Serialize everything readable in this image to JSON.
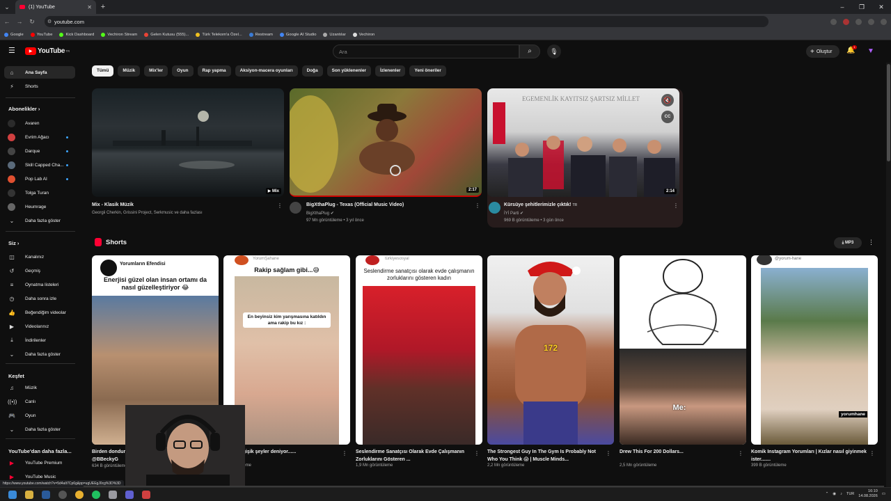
{
  "browser": {
    "tab_title": "(1) YouTube",
    "url": "youtube.com",
    "bookmarks": [
      "Google",
      "YouTube",
      "Kick Dashboard",
      "Vechiron Stream",
      "Gelen Kutusu (555)...",
      "Türk Telekom'a Özel...",
      "Restream",
      "Google AI Studio",
      "Uzantılar",
      "Vechiron"
    ],
    "status_url": "https://www.youtube.com/watch?v=5d4aIt7Cp6g&pp=ugUEEgJ0cg%3D%3D"
  },
  "header": {
    "logo": "YouTube",
    "logo_region": "TR",
    "search_placeholder": "Ara",
    "create_label": "Oluştur",
    "notification_count": "1"
  },
  "sidebar": {
    "home": "Ana Sayfa",
    "shorts": "Shorts",
    "subscriptions_title": "Abonelikler",
    "subscriptions": [
      {
        "name": "Avaren",
        "color": "#2b2b2b",
        "dot": false
      },
      {
        "name": "Evrim Ağacı",
        "color": "#d04040",
        "dot": true
      },
      {
        "name": "Darque",
        "color": "#444",
        "dot": true
      },
      {
        "name": "Skill Capped Cha...",
        "color": "#5a6a7a",
        "dot": true
      },
      {
        "name": "Pop Lab AI",
        "color": "#e05030",
        "dot": true
      },
      {
        "name": "Tolga Turan",
        "color": "#333",
        "dot": false
      },
      {
        "name": "Heumrage",
        "color": "#666",
        "dot": false
      }
    ],
    "show_more": "Daha fazla göster",
    "you_title": "Siz",
    "you_items": [
      "Kanalınız",
      "Geçmiş",
      "Oynatma listeleri",
      "Daha sonra izle",
      "Beğendiğim videolar",
      "Videolarınız",
      "İndirilenler",
      "Daha fazla göster"
    ],
    "explore_title": "Keşfet",
    "explore_items": [
      "Müzik",
      "Canlı",
      "Oyun",
      "Daha fazla göster"
    ],
    "more_title": "YouTube'dan daha fazla...",
    "more_items": [
      "YouTube Premium",
      "YouTube Music"
    ]
  },
  "chips": [
    "Tümü",
    "Müzik",
    "Mix'ler",
    "Oyun",
    "Rap yapma",
    "Aksiyon-macera oyunları",
    "Doğa",
    "Son yüklenenler",
    "İzlenenler",
    "Yeni öneriler"
  ],
  "videos": [
    {
      "title": "Mix - Klasik Müzik",
      "meta": "Georgii Cherkin, Grissini Project, Serkmusic ve daha fazlası",
      "badge": "Mix",
      "channel": "",
      "stats": ""
    },
    {
      "title": "BigXthaPlug - Texas (Official Music Video)",
      "channel": "BigXthaPlug",
      "stats": "97 Mn görüntüleme • 3 yıl önce",
      "badge": "2:17"
    },
    {
      "title": "Kürsüye şehitlerimizle çıktık!",
      "title_badge": "TR",
      "channel": "İYİ Parti",
      "stats": "969 B görüntüleme • 3 gün önce",
      "badge": "2:14"
    }
  ],
  "shorts": {
    "title": "Shorts",
    "mp3_label": "MP3",
    "items": [
      {
        "title": "Birden dondurmacılık yapmaya başlayan turist😂 @BBeckyG",
        "views": "634 B görüntüleme",
        "overlay_channel": "Yorumların Efendisi",
        "overlay_text": "Enerjisi güzel olan insan ortamı da nasıl güzelleştiriyor 😂"
      },
      {
        "title": "...ınız değişik şeyler deniyor......",
        "views": "... görüntüleme",
        "overlay_channel": "YorumŞahane",
        "overlay_text": "Rakip sağlam gibi...😅",
        "overlay_text2": "En beyinsiz kim yarışmasına katıldın ama rakip bu kız :"
      },
      {
        "title": "Seslendirme Sanatçısı Olarak Evde Çalışmanın Zorluklarını Gösteren ...",
        "views": "1,9 Mn görüntüleme",
        "overlay_channel": "türkiyesosyal",
        "overlay_text": "Seslendirme sanatçısı olarak evde çalışmanın zorluklarını gösteren kadın"
      },
      {
        "title": "The Strongest Guy In The Gym Is Probably Not Who You Think 😱 | Muscle Minds...",
        "views": "2,2 Mn görüntüleme",
        "overlay_text": "172"
      },
      {
        "title": "Drew This For 200 Dollars...",
        "views": "2,5 Mn görüntüleme",
        "overlay_text": "Me:"
      },
      {
        "title": "Komik Instagram Yorumları | Kızlar nasıl giyinmek ister.......",
        "views": "399 B görüntüleme",
        "overlay_channel": "@yorum-hane",
        "overlay_text": "yorumhane"
      }
    ]
  },
  "taskbar": {
    "lang": "TUR",
    "time": "16:10",
    "date": "14.08.2026"
  }
}
